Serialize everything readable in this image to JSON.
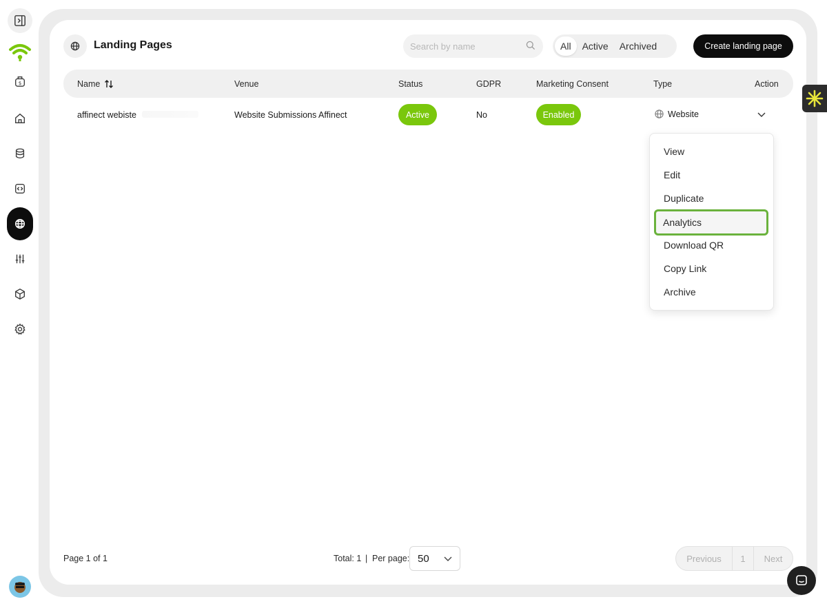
{
  "header": {
    "title": "Landing Pages",
    "search_placeholder": "Search by name",
    "filters": [
      "All",
      "Active",
      "Archived"
    ],
    "selected_filter": "All",
    "create_label": "Create landing page"
  },
  "table": {
    "columns": {
      "name": "Name",
      "venue": "Venue",
      "status": "Status",
      "gdpr": "GDPR",
      "marketing": "Marketing Consent",
      "type": "Type",
      "action": "Action"
    },
    "rows": [
      {
        "name": "affinect webiste",
        "venue": "Website Submissions Affinect",
        "status": "Active",
        "gdpr": "No",
        "marketing": "Enabled",
        "type": "Website"
      }
    ]
  },
  "action_menu": {
    "items": [
      "View",
      "Edit",
      "Duplicate",
      "Analytics",
      "Download QR",
      "Copy Link",
      "Archive"
    ],
    "highlighted": "Analytics"
  },
  "footer": {
    "page_info": "Page 1 of 1",
    "total": "Total: 1",
    "separator": "|",
    "per_page_label": "Per page:",
    "per_page_value": "50",
    "prev_label": "Previous",
    "current_page": "1",
    "next_label": "Next"
  },
  "colors": {
    "accent_green": "#7ac70c",
    "highlight_border": "#6ab23c",
    "primary_dark": "#0d0d0d",
    "frame_gray": "#ececec"
  },
  "icons": {
    "sidebar": [
      "sidebar-toggle-icon",
      "wifi-logo-icon",
      "money-bag-icon",
      "home-icon",
      "database-icon",
      "code-icon",
      "globe-icon",
      "sliders-icon",
      "cube-icon",
      "gear-icon"
    ]
  }
}
